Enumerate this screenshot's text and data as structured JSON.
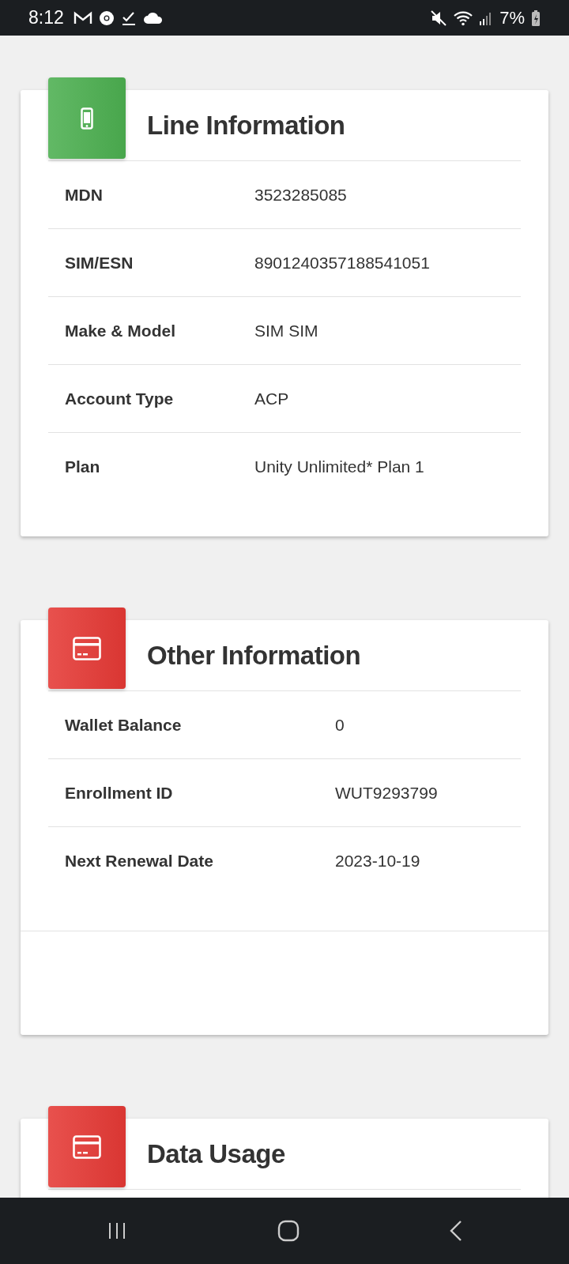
{
  "status_bar": {
    "time": "8:12",
    "battery": "7%"
  },
  "cards": [
    {
      "title": "Line Information",
      "kind": "phone",
      "color": "#4caf50",
      "footer": false,
      "rows": [
        {
          "label": "MDN",
          "value": "3523285085"
        },
        {
          "label": "SIM/ESN",
          "value": "8901240357188541051"
        },
        {
          "label": "Make & Model",
          "value": "SIM SIM"
        },
        {
          "label": "Account Type",
          "value": "ACP"
        },
        {
          "label": "Plan",
          "value": "Unity Unlimited* Plan 1"
        }
      ]
    },
    {
      "title": "Other Information",
      "kind": "card",
      "color": "#e53935",
      "footer": true,
      "rows": [
        {
          "label": "Wallet Balance",
          "value": "0"
        },
        {
          "label": "Enrollment ID",
          "value": "WUT9293799"
        },
        {
          "label": "Next Renewal Date",
          "value": "2023-10-19"
        }
      ]
    },
    {
      "title": "Data Usage",
      "kind": "card",
      "color": "#e53935",
      "footer": false
    }
  ]
}
